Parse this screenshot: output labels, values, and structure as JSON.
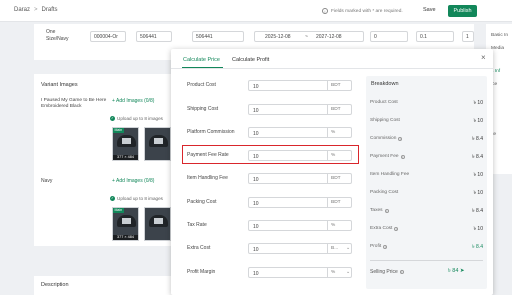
{
  "breadcrumb": {
    "root": "Daraz",
    "separator": ">",
    "current": "Drafts"
  },
  "header": {
    "required_note": "Fields marked with * are required.",
    "save_label": "Save",
    "publish_label": "Publish"
  },
  "sku_row": {
    "label": "One Size/Navy",
    "seller_sku": "000004-Or",
    "price": "506441",
    "special_price": "506441",
    "date_start": "2025-12-08",
    "date_sep": "~",
    "date_end": "2027-12-08",
    "qty1": "0",
    "qty2": "0.1",
    "qty3": "1"
  },
  "side_panel": {
    "items": [
      "Basic In",
      "Media",
      "s Inf",
      "ice",
      "ke"
    ]
  },
  "variants": {
    "title": "Variant Images",
    "v1_name": "I Paused My Game to Be Here Embroidered Black",
    "v2_name": "Navy",
    "add_images": "+ Add Images (0/8)",
    "upload_note": "Upload up to 8 images",
    "main_badge": "Main",
    "dims": "377 × 484"
  },
  "description": {
    "title": "Description"
  },
  "calculator": {
    "tabs": [
      "Calculate Price",
      "Calculate Profit"
    ],
    "close": "×",
    "fields": [
      {
        "label": "Product Cost",
        "value": "10",
        "unit": "BDT"
      },
      {
        "label": "Shipping Cost",
        "value": "10",
        "unit": "BDT"
      },
      {
        "label": "Platform Commission",
        "value": "10",
        "unit": "%"
      },
      {
        "label": "Payment Fee Rate",
        "value": "10",
        "unit": "%"
      },
      {
        "label": "Item Handling Fee",
        "value": "10",
        "unit": "BDT"
      },
      {
        "label": "Packing Cost",
        "value": "10",
        "unit": "BDT"
      },
      {
        "label": "Tax Rate",
        "value": "10",
        "unit": "%"
      },
      {
        "label": "Extra Cost",
        "value": "10",
        "unit": "B..."
      },
      {
        "label": "Profit Margin",
        "value": "10",
        "unit": "%"
      }
    ],
    "breakdown": {
      "title": "Breakdown",
      "rows": [
        {
          "label": "Product Cost",
          "value": "৳ 10"
        },
        {
          "label": "Shipping Cost",
          "value": "৳ 10"
        },
        {
          "label": "Commission",
          "value": "৳ 8.4"
        },
        {
          "label": "Payment Fee",
          "value": "৳ 8.4"
        },
        {
          "label": "Item Handling Fee",
          "value": "৳ 10"
        },
        {
          "label": "Packing Cost",
          "value": "৳ 10"
        },
        {
          "label": "Taxes",
          "value": "৳ 8.4"
        },
        {
          "label": "Extra Cost",
          "value": "৳ 10"
        },
        {
          "label": "Profit",
          "value": "৳ 8.4"
        }
      ],
      "selling_label": "Selling Price",
      "selling_value": "৳ 84"
    }
  },
  "colors": {
    "accent": "#12875a",
    "highlight": "#d9262c"
  }
}
